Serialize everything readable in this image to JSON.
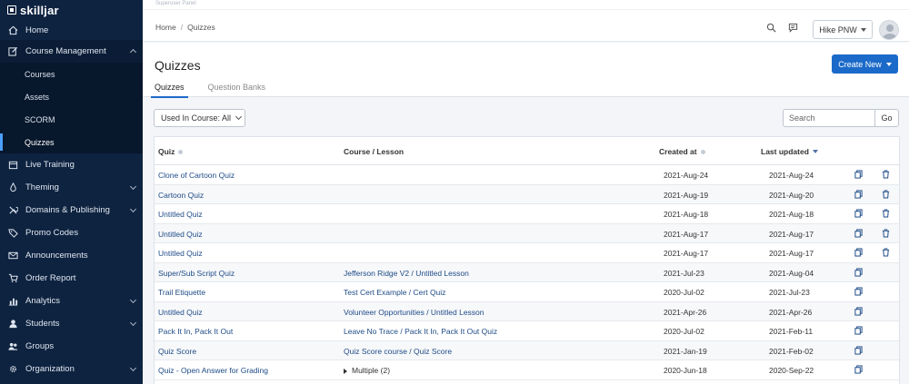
{
  "app": {
    "logo_text": "skilljar",
    "superuser_label": "Superuser Panel"
  },
  "sidebar": {
    "items": [
      {
        "label": "Home",
        "icon": "home-icon"
      },
      {
        "label": "Course Management",
        "icon": "edit-icon",
        "open": true
      },
      {
        "label": "Live Training",
        "icon": "calendar-icon"
      },
      {
        "label": "Theming",
        "icon": "droplet-icon"
      },
      {
        "label": "Domains & Publishing",
        "icon": "tools-icon"
      },
      {
        "label": "Promo Codes",
        "icon": "tag-icon"
      },
      {
        "label": "Announcements",
        "icon": "envelope-icon"
      },
      {
        "label": "Order Report",
        "icon": "cart-icon"
      },
      {
        "label": "Analytics",
        "icon": "chart-icon"
      },
      {
        "label": "Students",
        "icon": "user-icon"
      },
      {
        "label": "Groups",
        "icon": "users-icon"
      },
      {
        "label": "Organization",
        "icon": "gear-icon"
      }
    ],
    "course_management_sub": [
      "Courses",
      "Assets",
      "SCORM",
      "Quizzes"
    ]
  },
  "topbar": {
    "breadcrumb": [
      "Home",
      "Quizzes"
    ],
    "breadcrumb_sep": "/",
    "org_selector": "Hike PNW"
  },
  "page": {
    "title": "Quizzes",
    "create_button": "Create New",
    "tabs": [
      "Quizzes",
      "Question Banks"
    ],
    "filter_label": "Used In Course: All",
    "search_placeholder": "Search",
    "go_button": "Go"
  },
  "table": {
    "headers": {
      "quiz": "Quiz",
      "course": "Course / Lesson",
      "created": "Created at",
      "updated": "Last updated"
    },
    "rows": [
      {
        "quiz": "Clone of Cartoon Quiz",
        "course": "",
        "created": "2021-Aug-24",
        "updated": "2021-Aug-24",
        "trash": true
      },
      {
        "quiz": "Cartoon Quiz",
        "course": "",
        "created": "2021-Aug-19",
        "updated": "2021-Aug-20",
        "trash": true
      },
      {
        "quiz": "Untitled Quiz",
        "course": "",
        "created": "2021-Aug-18",
        "updated": "2021-Aug-18",
        "trash": true
      },
      {
        "quiz": "Untitled Quiz",
        "course": "",
        "created": "2021-Aug-17",
        "updated": "2021-Aug-17",
        "trash": true
      },
      {
        "quiz": "Untitled Quiz",
        "course": "",
        "created": "2021-Aug-17",
        "updated": "2021-Aug-17",
        "trash": true
      },
      {
        "quiz": "Super/Sub Script Quiz",
        "course": "Jefferson Ridge V2 / Untitled Lesson",
        "created": "2021-Jul-23",
        "updated": "2021-Aug-04",
        "trash": false
      },
      {
        "quiz": "Trail Etiquette",
        "course": "Test Cert Example / Cert Quiz",
        "created": "2020-Jul-02",
        "updated": "2021-Jul-23",
        "trash": false
      },
      {
        "quiz": "Untitled Quiz",
        "course": "Volunteer Opportunities / Untitled Lesson",
        "created": "2021-Apr-26",
        "updated": "2021-Apr-26",
        "trash": false
      },
      {
        "quiz": "Pack It In, Pack It Out",
        "course": "Leave No Trace / Pack It In, Pack It Out Quiz",
        "created": "2020-Jul-02",
        "updated": "2021-Feb-11",
        "trash": false
      },
      {
        "quiz": "Quiz Score",
        "course": "Quiz Score course / Quiz Score",
        "created": "2021-Jan-19",
        "updated": "2021-Feb-02",
        "trash": false
      },
      {
        "quiz": "Quiz - Open Answer for Grading",
        "course": "Multiple (2)",
        "created": "2020-Jun-18",
        "updated": "2020-Sep-22",
        "trash": false,
        "multiple": true
      }
    ]
  },
  "colors": {
    "sidebar_bg": "#0e2340",
    "accent": "#1b6ac9",
    "link": "#1e4b87"
  }
}
